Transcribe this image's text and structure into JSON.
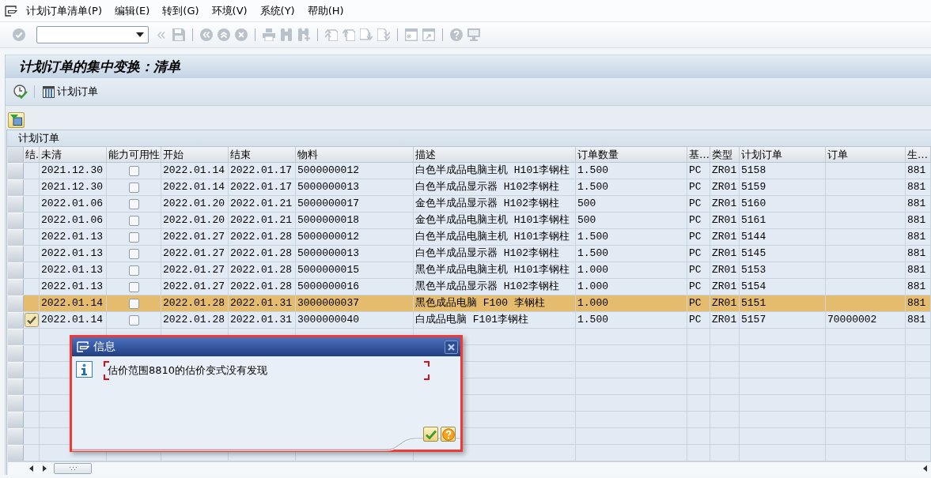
{
  "menu_bar": {
    "items": [
      "计划订单清单(P)",
      "编辑(E)",
      "转到(G)",
      "环境(V)",
      "系统(Y)",
      "帮助(H)"
    ]
  },
  "toolbar": {
    "disabled": true
  },
  "title": "计划订单的集中变换：清单",
  "app_toolbar": {
    "button_label": "计划订单"
  },
  "table": {
    "title": "计划订单",
    "columns": [
      {
        "label": "结.",
        "kind": "status"
      },
      {
        "label": "未清",
        "kind": "text"
      },
      {
        "label": "能力可用性",
        "kind": "checkbox"
      },
      {
        "label": "开始",
        "kind": "text"
      },
      {
        "label": "结束",
        "kind": "text"
      },
      {
        "label": "物料",
        "kind": "text"
      },
      {
        "label": "描述",
        "kind": "text"
      },
      {
        "label": "订单数量",
        "kind": "text"
      },
      {
        "label": "基…",
        "kind": "text"
      },
      {
        "label": "类型",
        "kind": "text"
      },
      {
        "label": "计划订单",
        "kind": "text"
      },
      {
        "label": "订单",
        "kind": "text"
      },
      {
        "label": "生…",
        "kind": "text"
      }
    ],
    "rows": [
      {
        "selected": false,
        "status_ok": false,
        "open": "2021.12.30",
        "capacity_checked": false,
        "start": "2022.01.14",
        "finish": "2022.01.17",
        "material": "5000000012",
        "description": "白色半成品电脑主机 H101李钢柱",
        "quantity": "1.500",
        "unit": "PC",
        "type": "ZR01",
        "planned_order": "5158",
        "column_13": "881"
      },
      {
        "selected": false,
        "status_ok": false,
        "open": "2021.12.30",
        "capacity_checked": false,
        "start": "2022.01.14",
        "finish": "2022.01.17",
        "material": "5000000013",
        "description": "白色半成品显示器 H102李钢柱",
        "quantity": "1.500",
        "unit": "PC",
        "type": "ZR01",
        "planned_order": "5159",
        "column_13": "881"
      },
      {
        "selected": false,
        "status_ok": false,
        "open": "2022.01.06",
        "capacity_checked": false,
        "start": "2022.01.20",
        "finish": "2022.01.21",
        "material": "5000000017",
        "description": "金色半成品显示器 H102李钢柱",
        "quantity": "500",
        "unit": "PC",
        "type": "ZR01",
        "planned_order": "5160",
        "column_13": "881"
      },
      {
        "selected": false,
        "status_ok": false,
        "open": "2022.01.06",
        "capacity_checked": false,
        "start": "2022.01.20",
        "finish": "2022.01.21",
        "material": "5000000018",
        "description": "金色半成品电脑主机 H101李钢柱",
        "quantity": "500",
        "unit": "PC",
        "type": "ZR01",
        "planned_order": "5161",
        "column_13": "881"
      },
      {
        "selected": false,
        "status_ok": false,
        "open": "2022.01.13",
        "capacity_checked": false,
        "start": "2022.01.27",
        "finish": "2022.01.28",
        "material": "5000000012",
        "description": "白色半成品电脑主机 H101李钢柱",
        "quantity": "1.500",
        "unit": "PC",
        "type": "ZR01",
        "planned_order": "5144",
        "column_13": "881"
      },
      {
        "selected": false,
        "status_ok": false,
        "open": "2022.01.13",
        "capacity_checked": false,
        "start": "2022.01.27",
        "finish": "2022.01.28",
        "material": "5000000013",
        "description": "白色半成品显示器 H102李钢柱",
        "quantity": "1.500",
        "unit": "PC",
        "type": "ZR01",
        "planned_order": "5145",
        "column_13": "881"
      },
      {
        "selected": false,
        "status_ok": false,
        "open": "2022.01.13",
        "capacity_checked": false,
        "start": "2022.01.27",
        "finish": "2022.01.28",
        "material": "5000000015",
        "description": "黑色半成品电脑主机 H101李钢柱",
        "quantity": "1.000",
        "unit": "PC",
        "type": "ZR01",
        "planned_order": "5153",
        "column_13": "881"
      },
      {
        "selected": false,
        "status_ok": false,
        "open": "2022.01.13",
        "capacity_checked": false,
        "start": "2022.01.27",
        "finish": "2022.01.28",
        "material": "5000000016",
        "description": "黑色半成品显示器 H102李钢柱",
        "quantity": "1.000",
        "unit": "PC",
        "type": "ZR01",
        "planned_order": "5154",
        "column_13": "881"
      },
      {
        "selected": true,
        "status_ok": false,
        "open": "2022.01.14",
        "capacity_checked": false,
        "start": "2022.01.28",
        "finish": "2022.01.31",
        "material": "3000000037",
        "description": "黑色成品电脑 F100 李钢柱",
        "quantity": "1.000",
        "unit": "PC",
        "type": "ZR01",
        "planned_order": "5151",
        "column_13": "881"
      },
      {
        "selected": false,
        "status_ok": true,
        "open": "2022.01.14",
        "capacity_checked": false,
        "start": "2022.01.28",
        "finish": "2022.01.31",
        "material": "3000000040",
        "description": "白成品电脑 F101李钢柱",
        "quantity": "1.500",
        "unit": "PC",
        "type": "ZR01",
        "planned_order": "5157",
        "order": "70000002",
        "column_13": "881"
      }
    ]
  },
  "dialog": {
    "title": "信息",
    "message": "估价范围8810的估价变式没有发现"
  }
}
